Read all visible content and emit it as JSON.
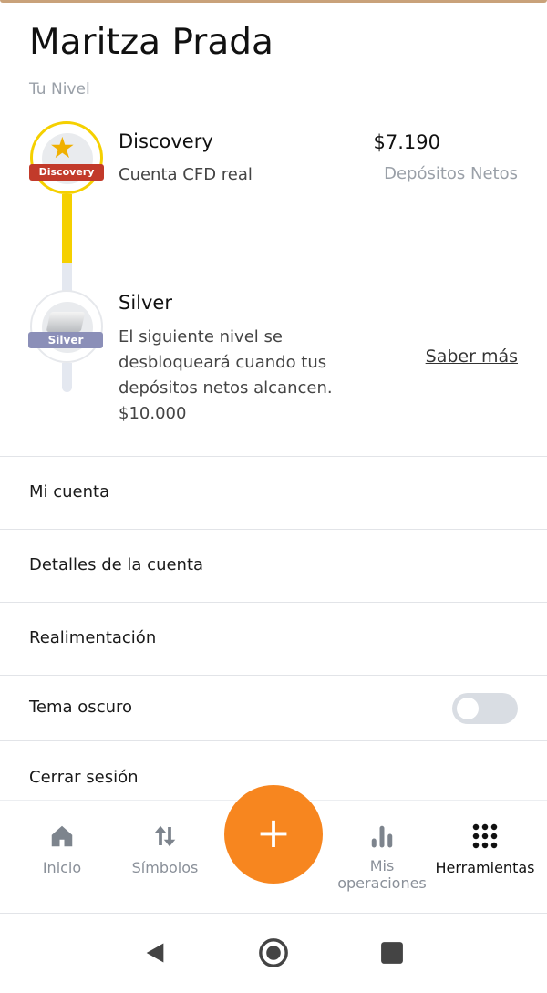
{
  "profile": {
    "name": "Maritza Prada",
    "level_caption": "Tu Nivel"
  },
  "levels": [
    {
      "badge_text": "Discovery",
      "title": "Discovery",
      "subtitle": "Cuenta CFD real",
      "amount": "$7.190",
      "amount_label": "Depósitos Netos",
      "icon": "star-icon",
      "current": true
    },
    {
      "badge_text": "Silver",
      "title": "Silver",
      "description_lines": [
        "El siguiente nivel se",
        "desbloqueará cuando tus",
        "depósitos netos alcancen.",
        "$10.000"
      ],
      "link": "Saber más",
      "icon": "silver-bar-icon",
      "current": false
    }
  ],
  "menu": [
    {
      "label": "Mi cuenta"
    },
    {
      "label": "Detalles de la cuenta"
    },
    {
      "label": "Realimentación"
    },
    {
      "label": "Tema oscuro",
      "toggle": false
    },
    {
      "label": "Cerrar sesión"
    }
  ],
  "bottom_nav": {
    "items": [
      {
        "label": "Inicio",
        "icon": "home-icon"
      },
      {
        "label": "Símbolos",
        "icon": "swap-arrows-icon"
      },
      {
        "label_line1": "Mis",
        "label_line2": "operaciones",
        "icon": "bar-chart-icon"
      },
      {
        "label": "Herramientas",
        "icon": "grid-dots-icon",
        "active": true
      }
    ],
    "fab_symbol": "+"
  },
  "colors": {
    "accent": "#f7861f",
    "gold": "#f5d000",
    "discovery_ribbon": "#c23a2a",
    "silver_ribbon": "#8b8fb8"
  }
}
